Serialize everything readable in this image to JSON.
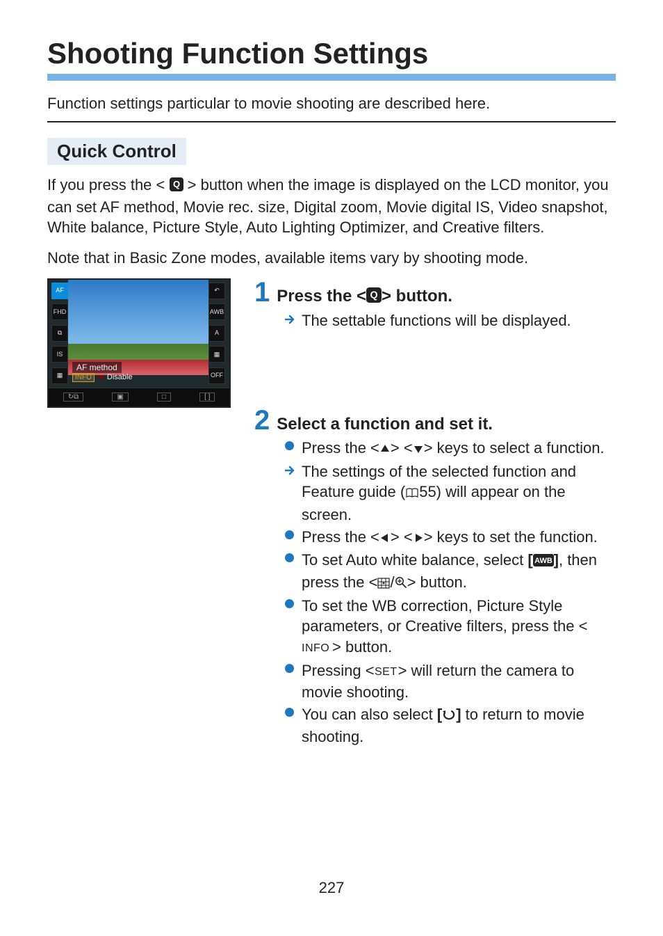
{
  "page": {
    "title": "Shooting Function Settings",
    "intro": "Function settings particular to movie shooting are described here.",
    "number": "227"
  },
  "section": {
    "heading": "Quick Control",
    "para1_a": "If you press the <",
    "para1_b": "> button when the image is displayed on the LCD monitor, you can set AF method, Movie rec. size, Digital zoom, Movie digital IS, Video snapshot, White balance, Picture Style, Auto Lighting Optimizer, and Creative filters.",
    "para2": "Note that in Basic Zone modes, available items vary by shooting mode."
  },
  "lcd": {
    "left_icons": [
      "AF",
      "FHD",
      "⧉",
      "IS",
      "▦"
    ],
    "right_icons": [
      "↶",
      "AWB",
      "A",
      "▦",
      "OFF"
    ],
    "label": "AF method",
    "info_badge": "INFO",
    "disable_text": "Disable",
    "bottom": [
      "↻⧉",
      "▣",
      "□",
      "[ ]"
    ]
  },
  "steps": [
    {
      "num": "1",
      "title_a": "Press the <",
      "title_b": "> button.",
      "items": [
        {
          "type": "arrow",
          "text": "The settable functions will be displayed."
        }
      ]
    },
    {
      "num": "2",
      "title_a": "Select a function and set it.",
      "title_b": "",
      "items": [
        {
          "type": "dot",
          "pre": "Press the <",
          "mid1": "> <",
          "post": "> keys to select a function.",
          "iconA": "up",
          "iconB": "down"
        },
        {
          "type": "arrow",
          "pre": "The settings of the selected function and Feature guide (",
          "post": "55) will appear on the screen.",
          "iconA": "book"
        },
        {
          "type": "dot",
          "pre": "Press the <",
          "mid1": "> <",
          "post": "> keys to set the function.",
          "iconA": "left",
          "iconB": "right"
        },
        {
          "type": "dot",
          "pre": "To set Auto white balance, select ",
          "mid1": ", then press the <",
          "mid2": "/",
          "post": "> button.",
          "iconA": "awb",
          "iconB": "grid",
          "iconC": "magnify"
        },
        {
          "type": "dot",
          "pre": "To set the WB correction, Picture Style parameters, or Creative filters, press the <",
          "post": "> button.",
          "iconA": "info"
        },
        {
          "type": "dot",
          "pre": "Pressing <",
          "post": "> will return the camera to movie shooting.",
          "iconA": "set"
        },
        {
          "type": "dot",
          "pre": "You can also select ",
          "post": " to return to movie shooting.",
          "iconA": "return"
        }
      ]
    }
  ],
  "icons": {
    "q": "Q"
  }
}
